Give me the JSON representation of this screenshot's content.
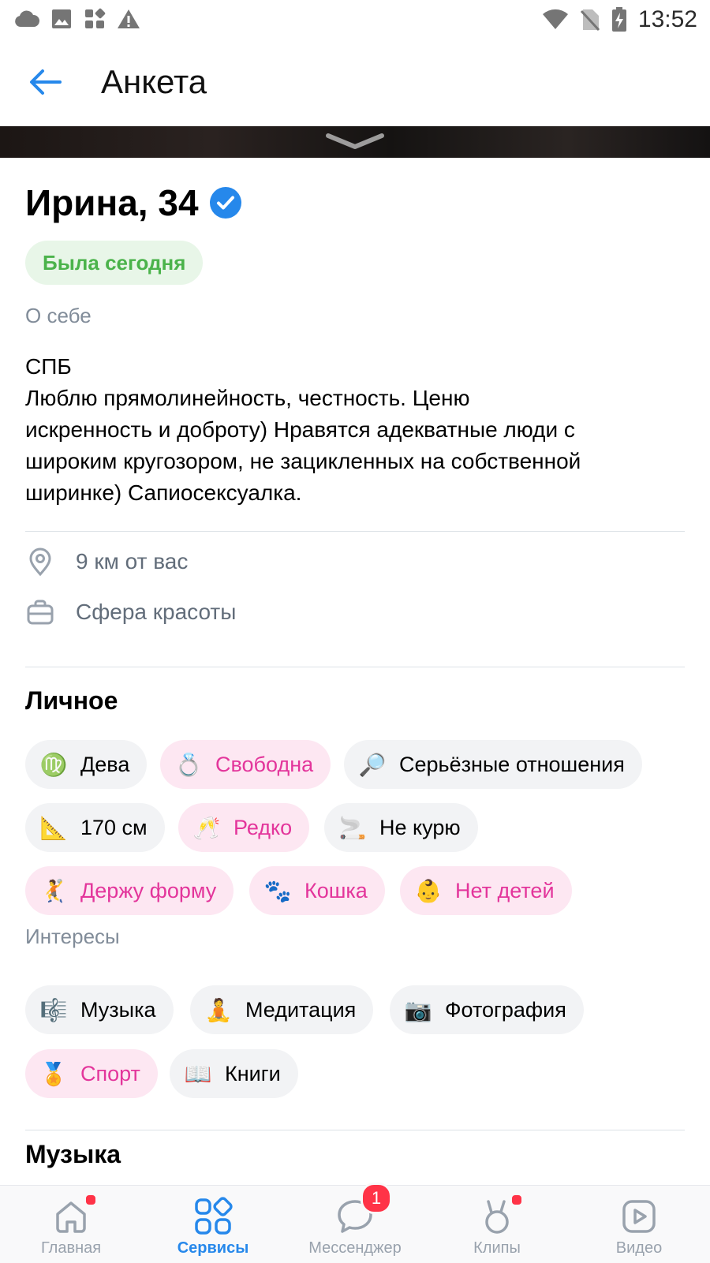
{
  "status_bar": {
    "time": "13:52",
    "left_icons": [
      "cloud-icon",
      "image-icon",
      "apps-icon",
      "warning-icon"
    ],
    "right_icons": [
      "wifi-icon",
      "no-sim-icon",
      "battery-charging-icon"
    ]
  },
  "header": {
    "title": "Анкета",
    "back_icon": "arrow-left-icon"
  },
  "profile": {
    "name": "Ирина, 34",
    "verified_icon": "verified-check-icon",
    "online_status": "Была сегодня",
    "about_label": "О себе",
    "about_lines": [
      "СПБ",
      "Люблю прямолинейность, честность. Ценю",
      "искренность и доброту) Нравятся адекватные люди с",
      "широким кругозором, не зацикленных на собственной",
      "ширинке) Сапиосексуалка."
    ],
    "distance": "9 км от вас",
    "occupation": "Сфера красоты"
  },
  "personal": {
    "title": "Личное",
    "chips": [
      {
        "emoji": "♍",
        "label": "Дева",
        "style": "gray"
      },
      {
        "emoji": "💍",
        "label": "Свободна",
        "style": "pink"
      },
      {
        "emoji": "🔎",
        "label": "Серьёзные отношения",
        "style": "gray"
      },
      {
        "emoji": "📐",
        "label": "170 см",
        "style": "gray"
      },
      {
        "emoji": "🥂",
        "label": "Редко",
        "style": "pink"
      },
      {
        "emoji": "🚬",
        "label": "Не курю",
        "style": "gray"
      },
      {
        "emoji": "🤾",
        "label": "Держу форму",
        "style": "pink"
      },
      {
        "emoji": "🐾",
        "label": "Кошка",
        "style": "pink"
      },
      {
        "emoji": "👶",
        "label": "Нет детей",
        "style": "pink"
      }
    ]
  },
  "interests": {
    "title": "Интересы",
    "chips": [
      {
        "emoji": "🎼",
        "label": "Музыка",
        "style": "gray"
      },
      {
        "emoji": "🧘",
        "label": "Медитация",
        "style": "gray"
      },
      {
        "emoji": "📷",
        "label": "Фотография",
        "style": "gray"
      },
      {
        "emoji": "🏅",
        "label": "Спорт",
        "style": "pink"
      },
      {
        "emoji": "📖",
        "label": "Книги",
        "style": "gray"
      }
    ]
  },
  "music": {
    "title": "Музыка"
  },
  "tabbar": {
    "tabs": [
      {
        "label": "Главная",
        "icon": "home-icon"
      },
      {
        "label": "Сервисы",
        "icon": "services-icon",
        "active": true
      },
      {
        "label": "Мессенджер",
        "icon": "messenger-icon",
        "badge": "1"
      },
      {
        "label": "Клипы",
        "icon": "clips-icon"
      },
      {
        "label": "Видео",
        "icon": "video-icon"
      }
    ]
  },
  "colors": {
    "accent": "#2688eb",
    "online_green": "#4bb34b",
    "pink": "#e3359b",
    "pink_bg": "#fde7f2",
    "gray_bg": "#f2f3f5",
    "badge_red": "#ff3347"
  }
}
